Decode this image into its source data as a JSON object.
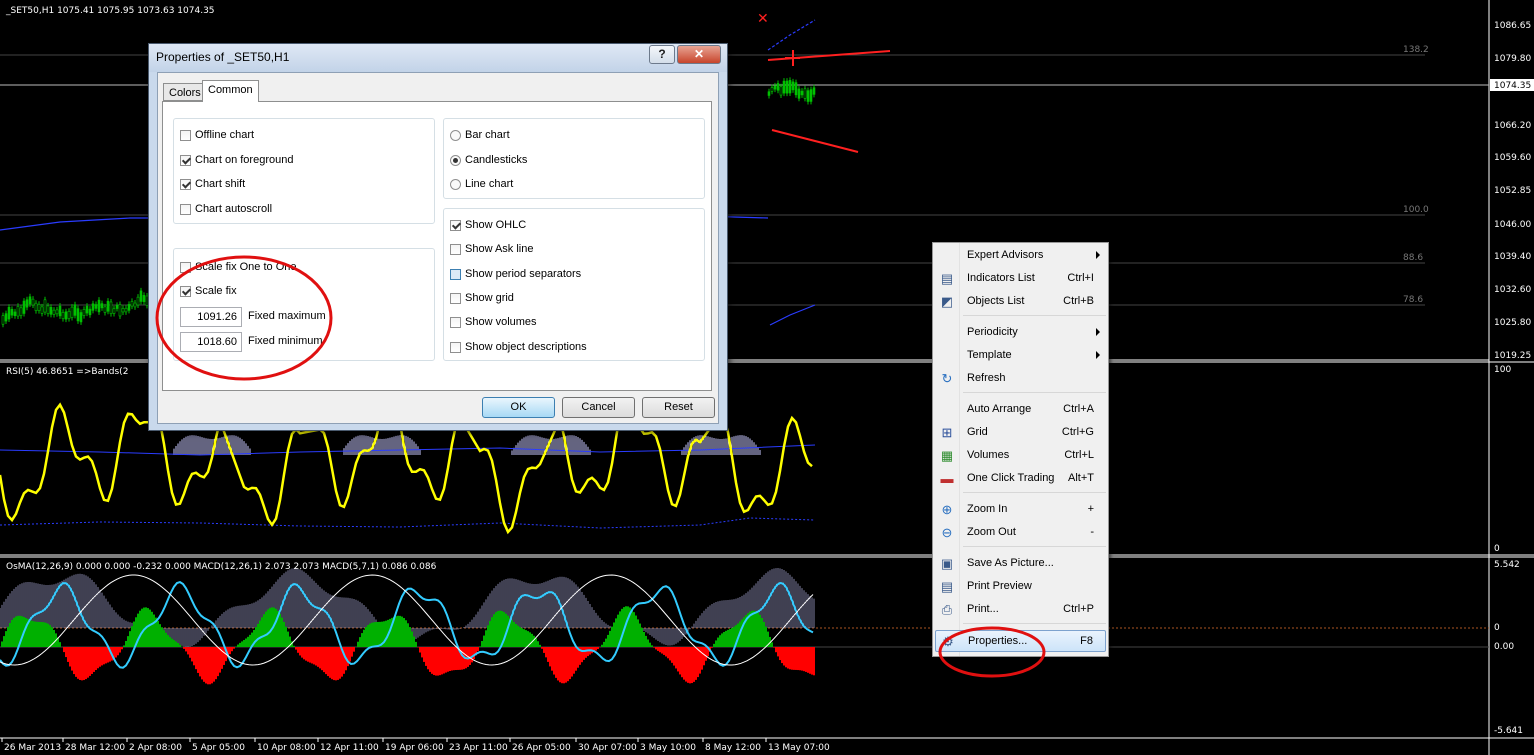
{
  "chart": {
    "header": "_SET50,H1  1075.41 1075.95 1073.63 1074.35",
    "price_axis": [
      "1086.65",
      "1079.80",
      "1074.35",
      "1066.20",
      "1059.60",
      "1052.85",
      "1046.00",
      "1039.40",
      "1032.60",
      "1025.80",
      "1019.25"
    ],
    "current_price": "1074.35",
    "fib_levels": [
      "138.2",
      "100.0",
      "88.6",
      "78.6"
    ],
    "rsi_label": "RSI(5) 46.8651  =>Bands(2",
    "rsi_axis": [
      "100",
      "0"
    ],
    "macd_label": "OsMA(12,26,9) 0.000 0.000 -0.232 0.000  MACD(12,26,1) 2.073 2.073  MACD(5,7,1) 0.086 0.086",
    "macd_axis": [
      "5.542",
      "0",
      "0.00",
      "-5.641"
    ],
    "time_axis": [
      "26 Mar 2013",
      "28 Mar 12:00",
      "2 Apr 08:00",
      "5 Apr 05:00",
      "10 Apr 08:00",
      "12 Apr 11:00",
      "19 Apr 06:00",
      "23 Apr 11:00",
      "26 Apr 05:00",
      "30 Apr 07:00",
      "3 May 10:00",
      "8 May 12:00",
      "13 May 07:00"
    ],
    "colors": {
      "bull": "#00c000",
      "bear": "#ff0000",
      "rsi": "#ffff00",
      "macd": "#33ccff",
      "bands": "#2a3cff",
      "histogram": "#c8c8ff"
    }
  },
  "dialog": {
    "title": "Properties of _SET50,H1",
    "help_button": "?",
    "close_button": "✕",
    "tabs": [
      "Colors",
      "Common"
    ],
    "active_tab": "Common",
    "left_group1": [
      {
        "label": "Offline chart",
        "checked": false
      },
      {
        "label": "Chart on foreground",
        "checked": true
      },
      {
        "label": "Chart shift",
        "checked": true
      },
      {
        "label": "Chart autoscroll",
        "checked": false
      }
    ],
    "left_group2": [
      {
        "label": "Scale fix One to One",
        "checked": false
      },
      {
        "label": "Scale fix",
        "checked": true
      }
    ],
    "fixed_max": {
      "value": "1091.26",
      "label": "Fixed maximum"
    },
    "fixed_min": {
      "value": "1018.60",
      "label": "Fixed minimum"
    },
    "chart_types": [
      {
        "label": "Bar chart",
        "checked": false
      },
      {
        "label": "Candlesticks",
        "checked": true
      },
      {
        "label": "Line chart",
        "checked": false
      }
    ],
    "right_group2": [
      {
        "label": "Show OHLC",
        "checked": true
      },
      {
        "label": "Show Ask line",
        "checked": false
      },
      {
        "label": "Show period separators",
        "checked": false
      },
      {
        "label": "Show grid",
        "checked": false
      },
      {
        "label": "Show volumes",
        "checked": false
      },
      {
        "label": "Show object descriptions",
        "checked": false
      }
    ],
    "buttons": {
      "ok": "OK",
      "cancel": "Cancel",
      "reset": "Reset"
    }
  },
  "context_menu": {
    "items": [
      {
        "label": "Expert Advisors",
        "shortcut": "",
        "submenu": true,
        "icon": "none"
      },
      {
        "label": "Indicators List",
        "shortcut": "Ctrl+I",
        "submenu": false,
        "icon": "indicators-list-icon"
      },
      {
        "label": "Objects List",
        "shortcut": "Ctrl+B",
        "submenu": false,
        "icon": "objects-list-icon"
      },
      {
        "label": "Periodicity",
        "shortcut": "",
        "submenu": true,
        "icon": "none"
      },
      {
        "label": "Template",
        "shortcut": "",
        "submenu": true,
        "icon": "none"
      },
      {
        "label": "Refresh",
        "shortcut": "",
        "submenu": false,
        "icon": "refresh-icon"
      },
      {
        "label": "Auto Arrange",
        "shortcut": "Ctrl+A",
        "submenu": false,
        "icon": "none"
      },
      {
        "label": "Grid",
        "shortcut": "Ctrl+G",
        "submenu": false,
        "icon": "grid-icon"
      },
      {
        "label": "Volumes",
        "shortcut": "Ctrl+L",
        "submenu": false,
        "icon": "volumes-icon"
      },
      {
        "label": "One Click Trading",
        "shortcut": "Alt+T",
        "submenu": false,
        "icon": "one-click-trading-icon"
      },
      {
        "label": "Zoom In",
        "shortcut": "+",
        "submenu": false,
        "icon": "zoom-in-icon"
      },
      {
        "label": "Zoom Out",
        "shortcut": "-",
        "submenu": false,
        "icon": "zoom-out-icon"
      },
      {
        "label": "Save As Picture...",
        "shortcut": "",
        "submenu": false,
        "icon": "save-picture-icon"
      },
      {
        "label": "Print Preview",
        "shortcut": "",
        "submenu": false,
        "icon": "print-preview-icon"
      },
      {
        "label": "Print...",
        "shortcut": "Ctrl+P",
        "submenu": false,
        "icon": "print-icon"
      },
      {
        "label": "Properties...",
        "shortcut": "F8",
        "submenu": false,
        "icon": "properties-icon"
      }
    ]
  }
}
